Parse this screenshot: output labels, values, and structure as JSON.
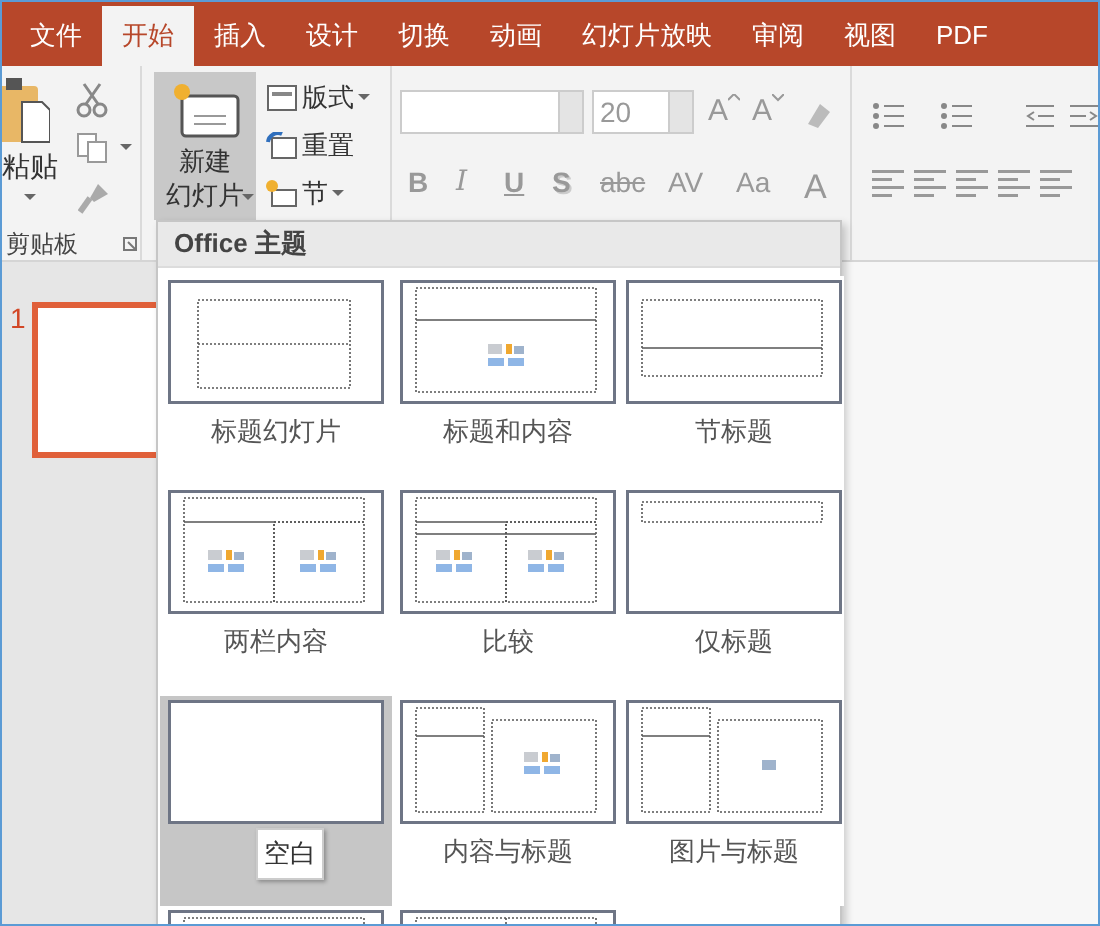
{
  "tabs": [
    {
      "label": "文件",
      "selected": false
    },
    {
      "label": "开始",
      "selected": true
    },
    {
      "label": "插入",
      "selected": false
    },
    {
      "label": "设计",
      "selected": false
    },
    {
      "label": "切换",
      "selected": false
    },
    {
      "label": "动画",
      "selected": false
    },
    {
      "label": "幻灯片放映",
      "selected": false
    },
    {
      "label": "审阅",
      "selected": false
    },
    {
      "label": "视图",
      "selected": false
    },
    {
      "label": "PDF",
      "selected": false
    }
  ],
  "ribbon": {
    "clipboard": {
      "paste": "粘贴",
      "group_label": "剪贴板"
    },
    "slides": {
      "new_slide_lines": [
        "新建",
        "幻灯片"
      ],
      "layout": "版式",
      "reset": "重置",
      "section": "节"
    },
    "font": {
      "size": "20",
      "size_buttons": [
        {
          "kind": "grow",
          "label": "A"
        },
        {
          "kind": "shrink",
          "label": "A"
        }
      ],
      "format_buttons": [
        {
          "kind": "bold",
          "label": "B"
        },
        {
          "kind": "italic",
          "label": "I"
        },
        {
          "kind": "underline",
          "label": "U"
        },
        {
          "kind": "shadow",
          "label": "S"
        },
        {
          "kind": "strike",
          "label": "abc"
        },
        {
          "kind": "spacing",
          "label": "AV"
        },
        {
          "kind": "case",
          "label": "Aa"
        },
        {
          "kind": "color",
          "label": "A"
        }
      ]
    }
  },
  "slide_panel": {
    "slide_number": "1"
  },
  "layout_menu": {
    "header": "Office 主题",
    "tooltip": "空白",
    "layouts": [
      {
        "kind": "title",
        "label": "标题幻灯片",
        "selected": false
      },
      {
        "kind": "title-content",
        "label": "标题和内容",
        "selected": false
      },
      {
        "kind": "section",
        "label": "节标题",
        "selected": false
      },
      {
        "kind": "two-content",
        "label": "两栏内容",
        "selected": false
      },
      {
        "kind": "comparison",
        "label": "比较",
        "selected": false
      },
      {
        "kind": "title-only",
        "label": "仅标题",
        "selected": false
      },
      {
        "kind": "blank",
        "selected": true
      },
      {
        "kind": "content-caption",
        "label": "内容与标题",
        "selected": false
      },
      {
        "kind": "picture-caption",
        "label": "图片与标题",
        "selected": false
      },
      {
        "kind": "cut-off-title",
        "selected": false
      },
      {
        "kind": "cut-off-split",
        "selected": false
      }
    ]
  }
}
